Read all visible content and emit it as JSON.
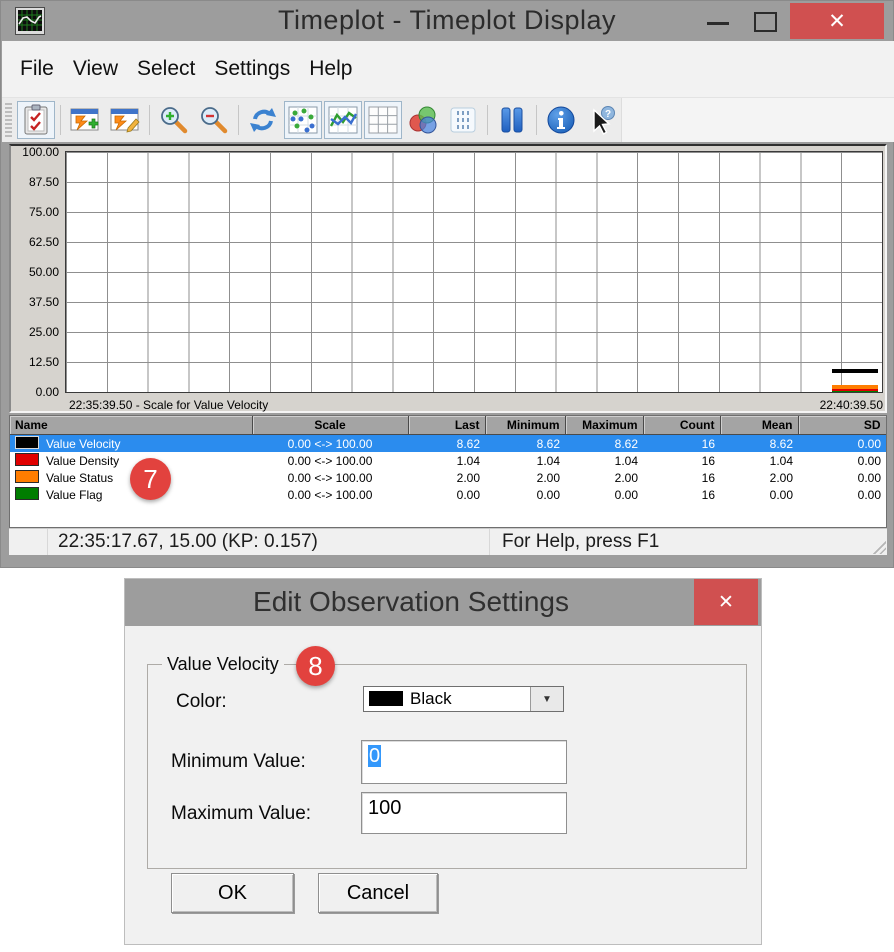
{
  "window": {
    "title": "Timeplot - Timeplot Display",
    "menu": [
      "File",
      "View",
      "Select",
      "Settings",
      "Help"
    ],
    "toolbar_icons": [
      "checklist-icon",
      "add-plot-icon",
      "edit-plot-icon",
      "zoom-in-icon",
      "zoom-out-icon",
      "refresh-icon",
      "scatter-plot-icon",
      "line-chart-icon",
      "grid-icon",
      "venn-circles-icon",
      "markers-icon",
      "pause-icon",
      "info-icon",
      "help-cursor-icon"
    ]
  },
  "icons": {
    "close_glyph": "✕",
    "dropdown_glyph": "▼"
  },
  "chart": {
    "y_ticks": [
      "100.00",
      "87.50",
      "75.00",
      "62.50",
      "50.00",
      "37.50",
      "25.00",
      "12.50",
      "0.00"
    ],
    "x_left_label": "22:35:39.50 - Scale for Value Velocity",
    "x_right_label": "22:40:39.50"
  },
  "chart_data": {
    "type": "line",
    "title": "Timeplot Display",
    "x_range": [
      "22:35:39.50",
      "22:40:39.50"
    ],
    "y_range": [
      0,
      100
    ],
    "grid": true,
    "visible_x_span": [
      0.939,
      0.995
    ],
    "series": [
      {
        "name": "Value Velocity",
        "color": "#000000",
        "value": 8.62,
        "thickness": 4
      },
      {
        "name": "Value Status",
        "color": "#ff7d00",
        "value": 2.0,
        "thickness": 4
      },
      {
        "name": "Value Density",
        "color": "#e00000",
        "value": 1.04,
        "thickness": 3
      },
      {
        "name": "Value Flag",
        "color": "#007d00",
        "value": 0.0,
        "thickness": 2
      }
    ]
  },
  "table": {
    "columns": [
      "Name",
      "Scale",
      "Last",
      "Minimum",
      "Maximum",
      "Count",
      "Mean",
      "SD"
    ],
    "rows": [
      {
        "swatch": "#000000",
        "name": "Value Velocity",
        "scale": "0.00 <-> 100.00",
        "last": "8.62",
        "min": "8.62",
        "max": "8.62",
        "count": "16",
        "mean": "8.62",
        "sd": "0.00",
        "selected": true
      },
      {
        "swatch": "#e00000",
        "name": "Value Density",
        "scale": "0.00 <-> 100.00",
        "last": "1.04",
        "min": "1.04",
        "max": "1.04",
        "count": "16",
        "mean": "1.04",
        "sd": "0.00",
        "selected": false
      },
      {
        "swatch": "#ff7d00",
        "name": "Value Status",
        "scale": "0.00 <-> 100.00",
        "last": "2.00",
        "min": "2.00",
        "max": "2.00",
        "count": "16",
        "mean": "2.00",
        "sd": "0.00",
        "selected": false
      },
      {
        "swatch": "#007d00",
        "name": "Value Flag",
        "scale": "0.00 <-> 100.00",
        "last": "0.00",
        "min": "0.00",
        "max": "0.00",
        "count": "16",
        "mean": "0.00",
        "sd": "0.00",
        "selected": false
      }
    ]
  },
  "status_bar": {
    "position_text": "22:35:17.67, 15.00 (KP: 0.157)",
    "help_text": "For Help, press F1"
  },
  "annotations": {
    "step7": "7",
    "step8": "8"
  },
  "dialog": {
    "title": "Edit Observation Settings",
    "group_label": "Value Velocity",
    "color_label": "Color:",
    "color_value": "Black",
    "color_swatch": "#000000",
    "minimum_label": "Minimum Value:",
    "minimum_value": "0",
    "maximum_label": "Maximum Value:",
    "maximum_value": "100",
    "ok_label": "OK",
    "cancel_label": "Cancel"
  },
  "colors": {
    "titlebar": "#9d9d9d",
    "close_button": "#d05050",
    "selection_blue": "#2b8cee",
    "badge_red": "#e2423e"
  }
}
